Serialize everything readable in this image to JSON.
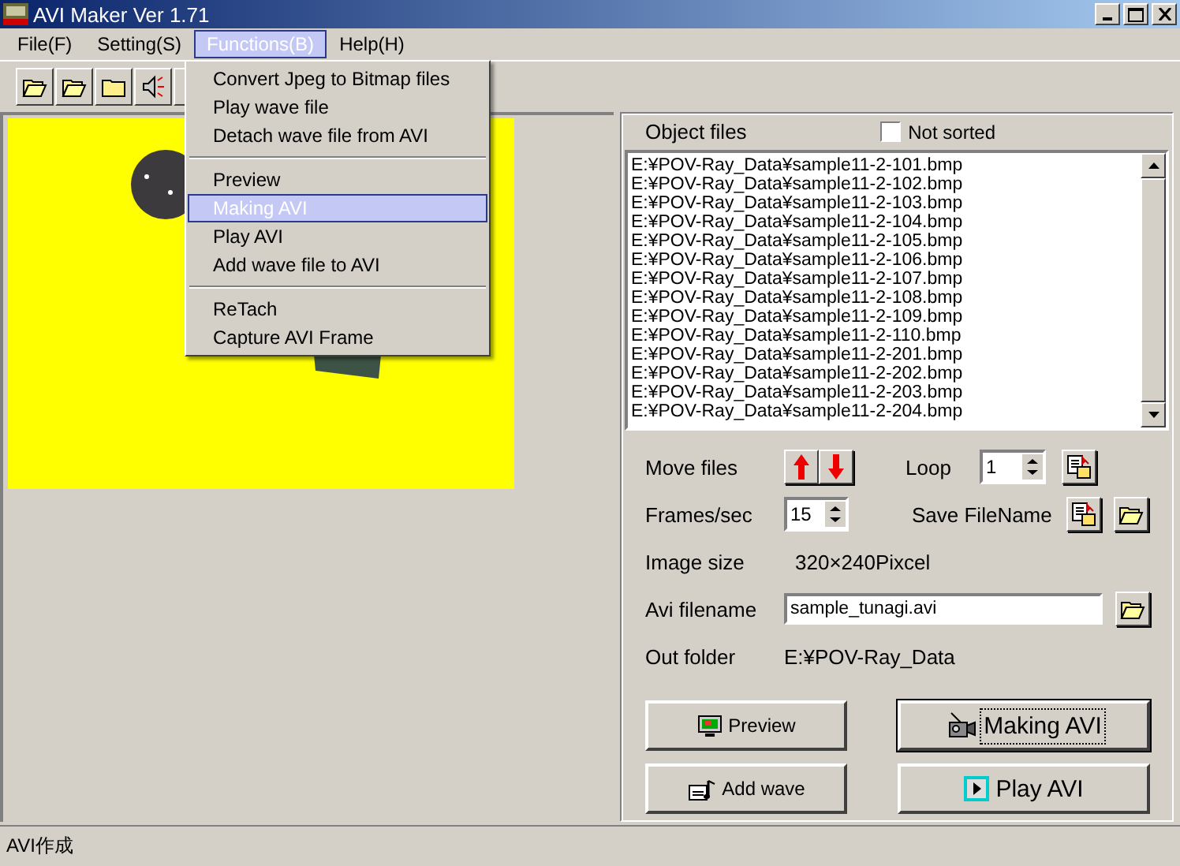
{
  "window": {
    "title": "AVI Maker Ver 1.71"
  },
  "menu_bar": [
    {
      "label": "File(F)",
      "selected": false
    },
    {
      "label": "Setting(S)",
      "selected": false
    },
    {
      "label": "Functions(B)",
      "selected": true
    },
    {
      "label": "Help(H)",
      "selected": false
    }
  ],
  "functions_menu": {
    "groups": [
      [
        {
          "label": "Convert Jpeg to Bitmap files",
          "selected": false
        },
        {
          "label": "Play wave file",
          "selected": false
        },
        {
          "label": "Detach wave file from AVI",
          "selected": false
        }
      ],
      [
        {
          "label": "Preview",
          "selected": false
        },
        {
          "label": "Making AVI",
          "selected": true
        },
        {
          "label": "Play AVI",
          "selected": false
        },
        {
          "label": "Add wave file to AVI",
          "selected": false
        }
      ],
      [
        {
          "label": "ReTach",
          "selected": false
        },
        {
          "label": "Capture AVI Frame",
          "selected": false
        }
      ]
    ]
  },
  "object_files": {
    "label": "Object files",
    "not_sorted": {
      "label": "Not sorted",
      "checked": false
    },
    "files": [
      "E:¥POV-Ray_Data¥sample11-2-101.bmp",
      "E:¥POV-Ray_Data¥sample11-2-102.bmp",
      "E:¥POV-Ray_Data¥sample11-2-103.bmp",
      "E:¥POV-Ray_Data¥sample11-2-104.bmp",
      "E:¥POV-Ray_Data¥sample11-2-105.bmp",
      "E:¥POV-Ray_Data¥sample11-2-106.bmp",
      "E:¥POV-Ray_Data¥sample11-2-107.bmp",
      "E:¥POV-Ray_Data¥sample11-2-108.bmp",
      "E:¥POV-Ray_Data¥sample11-2-109.bmp",
      "E:¥POV-Ray_Data¥sample11-2-110.bmp",
      "E:¥POV-Ray_Data¥sample11-2-201.bmp",
      "E:¥POV-Ray_Data¥sample11-2-202.bmp",
      "E:¥POV-Ray_Data¥sample11-2-203.bmp",
      "E:¥POV-Ray_Data¥sample11-2-204.bmp"
    ]
  },
  "move_files": {
    "label": "Move files"
  },
  "loop": {
    "label": "Loop",
    "value": "1"
  },
  "frames_per_sec": {
    "label": "Frames/sec",
    "value": "15"
  },
  "save_filename": {
    "label": "Save FileName"
  },
  "image_size": {
    "label": "Image size",
    "value": "320×240Pixcel"
  },
  "avi_filename": {
    "label": "Avi filename",
    "value": "sample_tunagi.avi"
  },
  "out_folder": {
    "label": "Out folder",
    "value": "E:¥POV-Ray_Data"
  },
  "buttons": [
    {
      "label": "Preview",
      "kind": "preview",
      "default": false
    },
    {
      "label": "Making AVI",
      "kind": "making",
      "default": true
    },
    {
      "label": "Add wave",
      "kind": "add_wave",
      "default": false
    },
    {
      "label": "Play AVI",
      "kind": "play",
      "default": false
    }
  ],
  "status_bar": {
    "text": "AVI作成"
  }
}
